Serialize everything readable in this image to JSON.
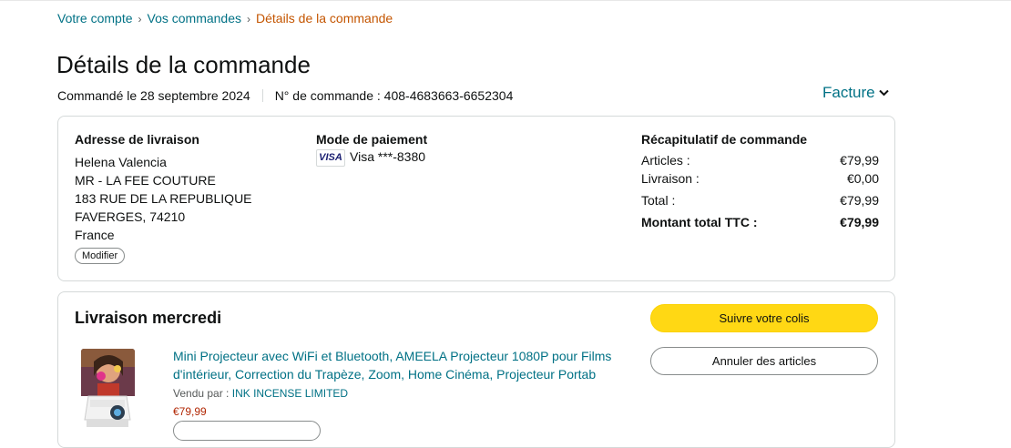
{
  "breadcrumb": {
    "items": [
      "Votre compte",
      "Vos commandes"
    ],
    "current": "Détails de la commande",
    "separator": "›"
  },
  "page_title": "Détails de la commande",
  "order": {
    "date_text": "Commandé le 28 septembre 2024",
    "number_text": "N° de commande : 408-4683663-6652304"
  },
  "invoice_label": "Facture",
  "shipping": {
    "heading": "Adresse de livraison",
    "lines": [
      "Helena Valencia",
      "MR - LA FEE COUTURE",
      "183 RUE DE LA REPUBLIQUE",
      "FAVERGES, 74210",
      "France"
    ],
    "modify_label": "Modifier"
  },
  "payment": {
    "heading": "Mode de paiement",
    "card_brand": "VISA",
    "card_text": "Visa ***-8380"
  },
  "summary": {
    "heading": "Récapitulatif de commande",
    "rows": [
      {
        "label": "Articles :",
        "value": "€79,99"
      },
      {
        "label": "Livraison :",
        "value": "€0,00"
      },
      {
        "label": "Total :",
        "value": "€79,99"
      },
      {
        "label": "Montant total TTC :",
        "value": "€79,99"
      }
    ]
  },
  "delivery": {
    "title": "Livraison mercredi",
    "track_label": "Suivre votre colis",
    "cancel_label": "Annuler des articles"
  },
  "product": {
    "title": "Mini Projecteur avec WiFi et Bluetooth, AMEELA Projecteur 1080P pour Films d'intérieur, Correction du Trapèze, Zoom, Home Cinéma, Projecteur Portab",
    "sold_by_label": "Vendu par :",
    "seller": "INK INCENSE LIMITED",
    "price": "€79,99"
  },
  "colors": {
    "link": "#007185",
    "breadcrumb_current": "#c45500",
    "primary_button": "#ffd814",
    "price": "#b12704",
    "border": "#d5d9d9"
  }
}
